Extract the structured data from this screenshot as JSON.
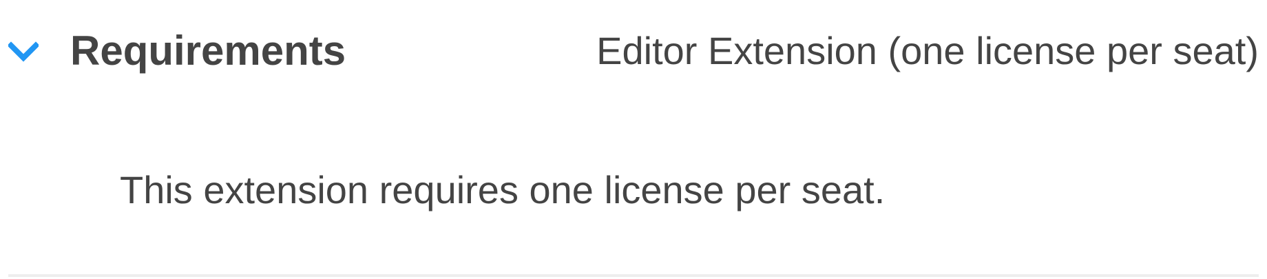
{
  "requirements": {
    "title": "Requirements",
    "summary": "Editor Extension (one license per seat)",
    "body": "This extension requires one license per seat.",
    "toggle_icon": "chevron-down-icon"
  },
  "colors": {
    "accent": "#2196F3",
    "text": "#444444",
    "divider": "#EEEEEE"
  }
}
